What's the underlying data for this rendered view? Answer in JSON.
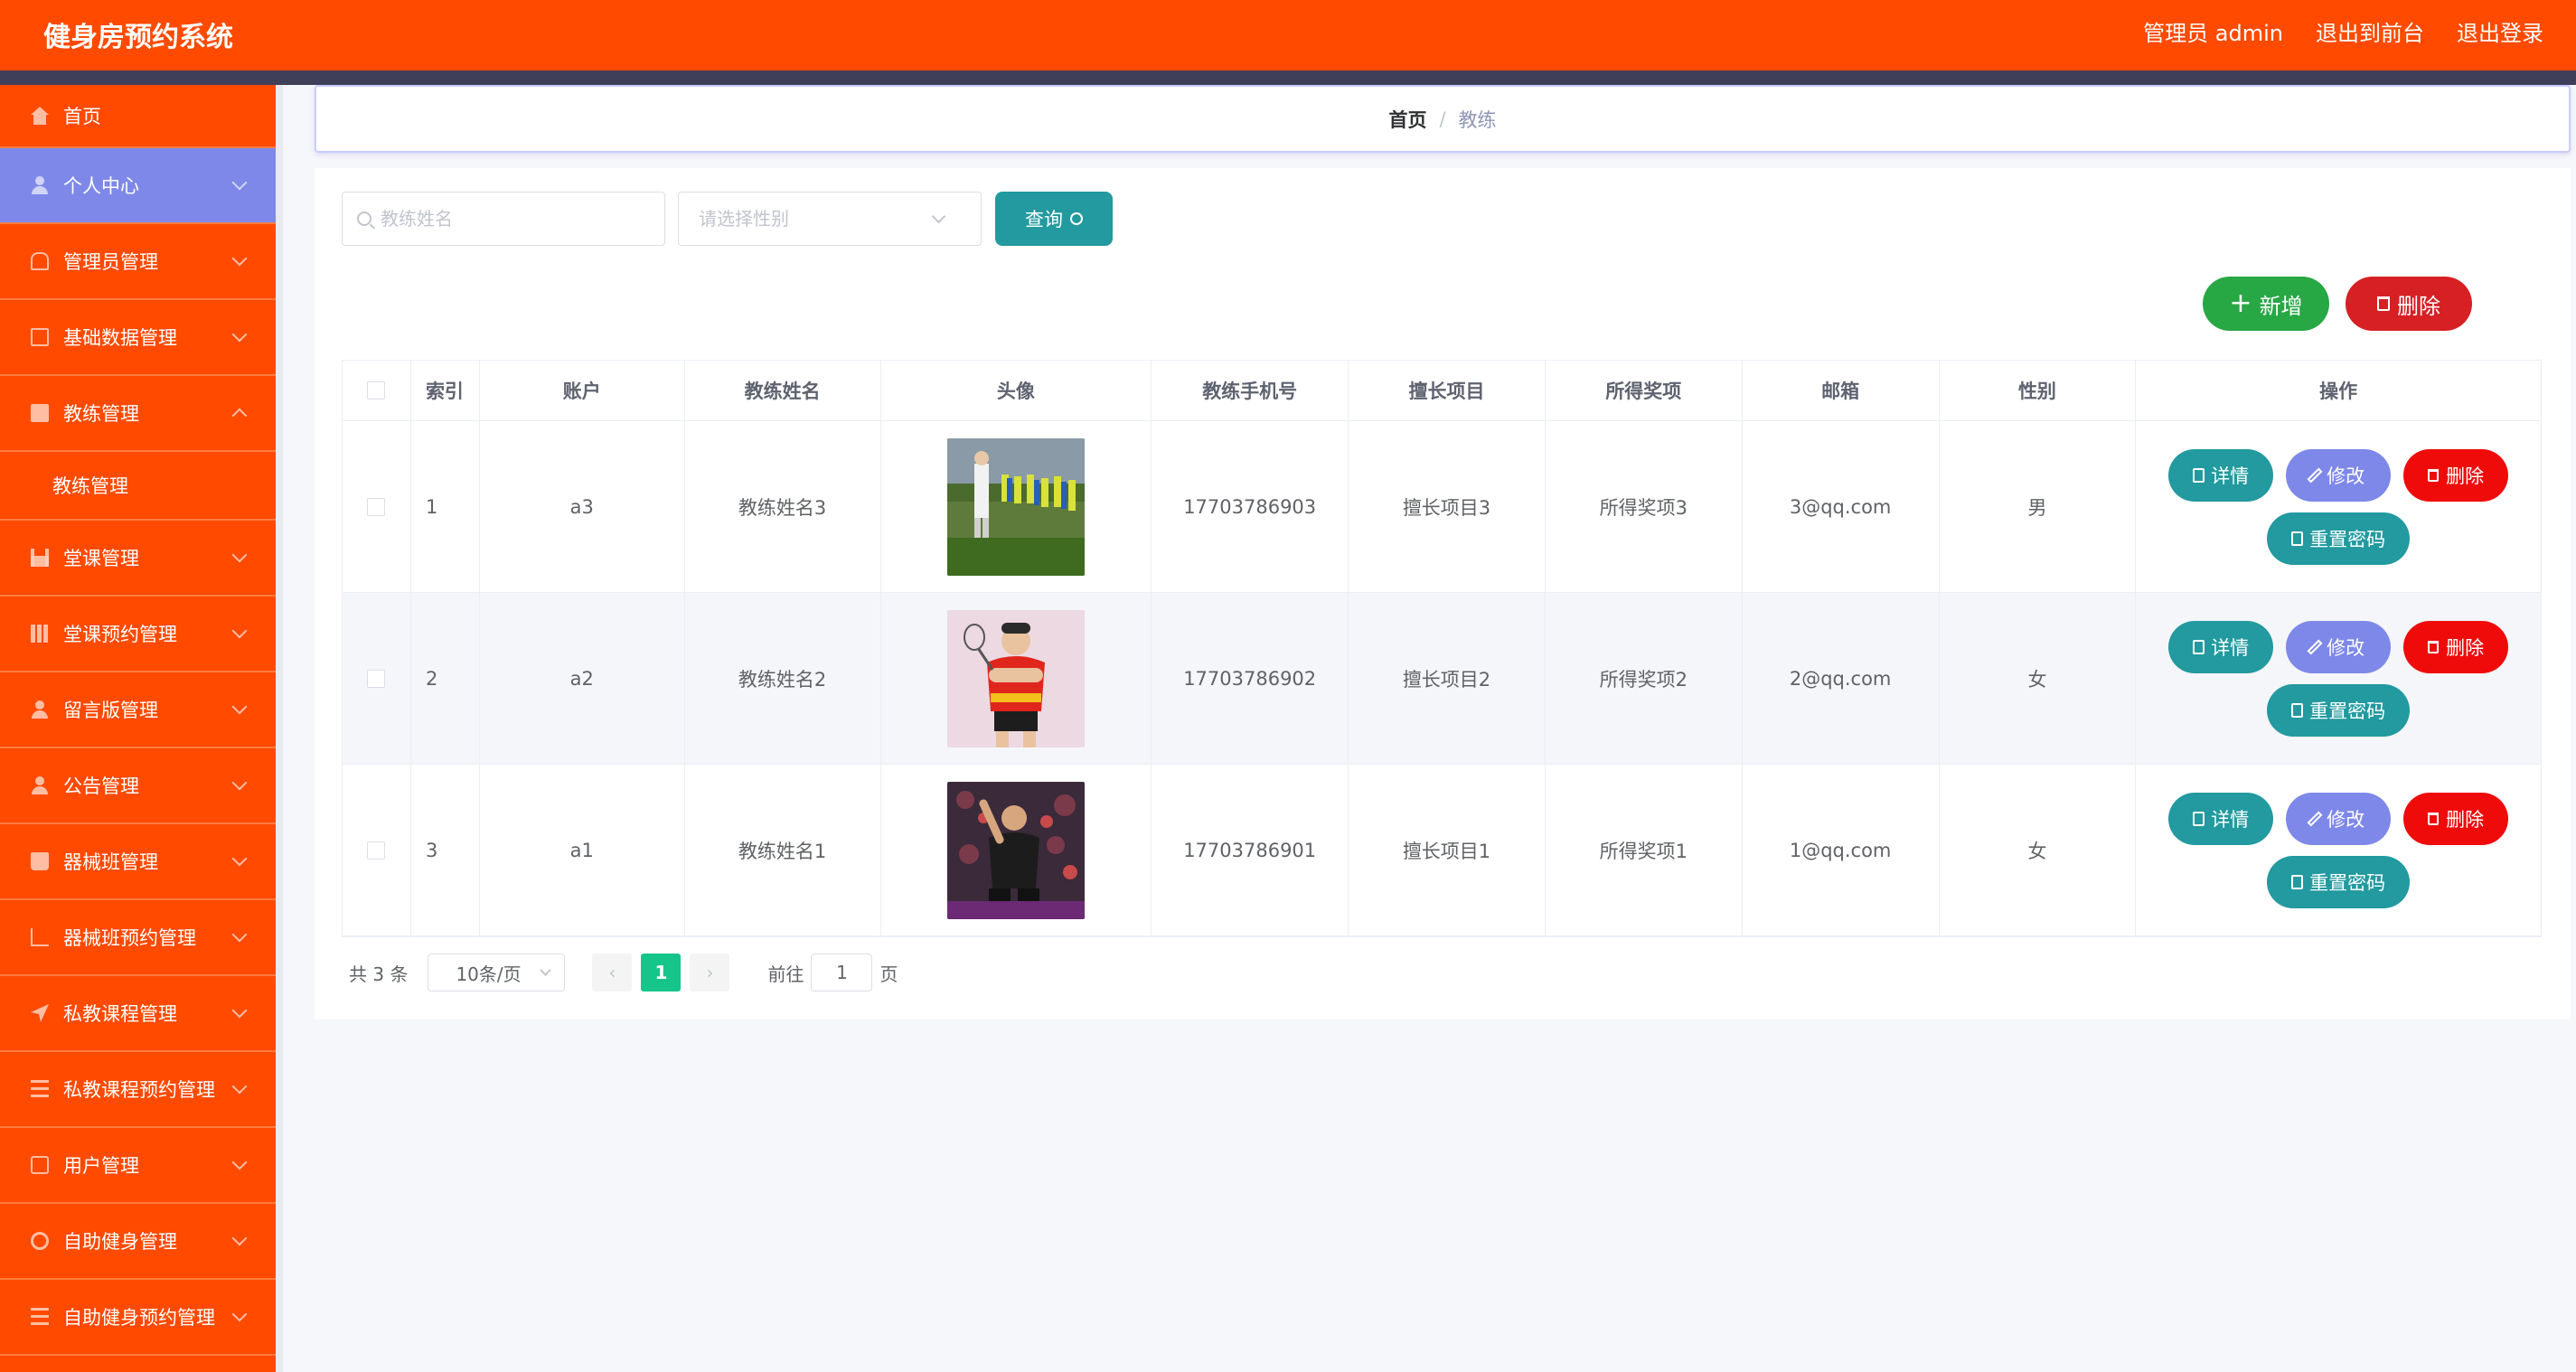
{
  "header": {
    "app_title": "健身房预约系统",
    "user_label": "管理员 admin",
    "front_label": "退出到前台",
    "logout_label": "退出登录"
  },
  "sidebar": {
    "items": [
      {
        "label": "首页",
        "icon": "home-icon"
      },
      {
        "label": "个人中心",
        "icon": "user-icon"
      },
      {
        "label": "管理员管理",
        "icon": "bell-icon"
      },
      {
        "label": "基础数据管理",
        "icon": "copy-icon"
      },
      {
        "label": "教练管理",
        "icon": "briefcase-icon"
      },
      {
        "label": "教练管理",
        "icon": ""
      },
      {
        "label": "堂课管理",
        "icon": "chart-icon"
      },
      {
        "label": "堂课预约管理",
        "icon": "grid-icon"
      },
      {
        "label": "留言版管理",
        "icon": "user-icon"
      },
      {
        "label": "公告管理",
        "icon": "user-icon"
      },
      {
        "label": "器械班管理",
        "icon": "book-icon"
      },
      {
        "label": "器械班预约管理",
        "icon": "crop-icon"
      },
      {
        "label": "私教课程管理",
        "icon": "send-icon"
      },
      {
        "label": "私教课程预约管理",
        "icon": "menu-icon"
      },
      {
        "label": "用户管理",
        "icon": "clipboard-icon"
      },
      {
        "label": "自助健身管理",
        "icon": "lifebuoy-icon"
      },
      {
        "label": "自助健身预约管理",
        "icon": "menu-icon"
      }
    ]
  },
  "breadcrumb": {
    "home": "首页",
    "separator": "/",
    "current": "教练"
  },
  "search": {
    "name_placeholder": "教练姓名",
    "sex_placeholder": "请选择性别",
    "query_label": "查询"
  },
  "actions": {
    "add_label": "新增",
    "delete_label": "删除"
  },
  "table": {
    "columns": [
      "索引",
      "账户",
      "教练姓名",
      "头像",
      "教练手机号",
      "擅长项目",
      "所得奖项",
      "邮箱",
      "性别",
      "操作"
    ],
    "rows": [
      {
        "index": "1",
        "account": "a3",
        "name": "教练姓名3",
        "phone": "17703786903",
        "skill": "擅长项目3",
        "award": "所得奖项3",
        "email": "3@qq.com",
        "sex": "男"
      },
      {
        "index": "2",
        "account": "a2",
        "name": "教练姓名2",
        "phone": "17703786902",
        "skill": "擅长项目2",
        "award": "所得奖项2",
        "email": "2@qq.com",
        "sex": "女"
      },
      {
        "index": "3",
        "account": "a1",
        "name": "教练姓名1",
        "phone": "17703786901",
        "skill": "擅长项目1",
        "award": "所得奖项1",
        "email": "1@qq.com",
        "sex": "女"
      }
    ],
    "row_actions": {
      "detail": "详情",
      "edit": "修改",
      "delete": "删除",
      "reset": "重置密码"
    }
  },
  "pagination": {
    "total_label": "共 3 条",
    "page_size": "10条/页",
    "current_page": "1",
    "jump_prefix": "前往",
    "jump_value": "1",
    "jump_suffix": "页"
  },
  "colors": {
    "header": "#ff4a00",
    "sidebar": "#ff4a00",
    "active_menu": "#7e88e8",
    "teal": "#229a9f",
    "green": "#28a745",
    "red": "#d62024",
    "page_active": "#16c58a"
  }
}
